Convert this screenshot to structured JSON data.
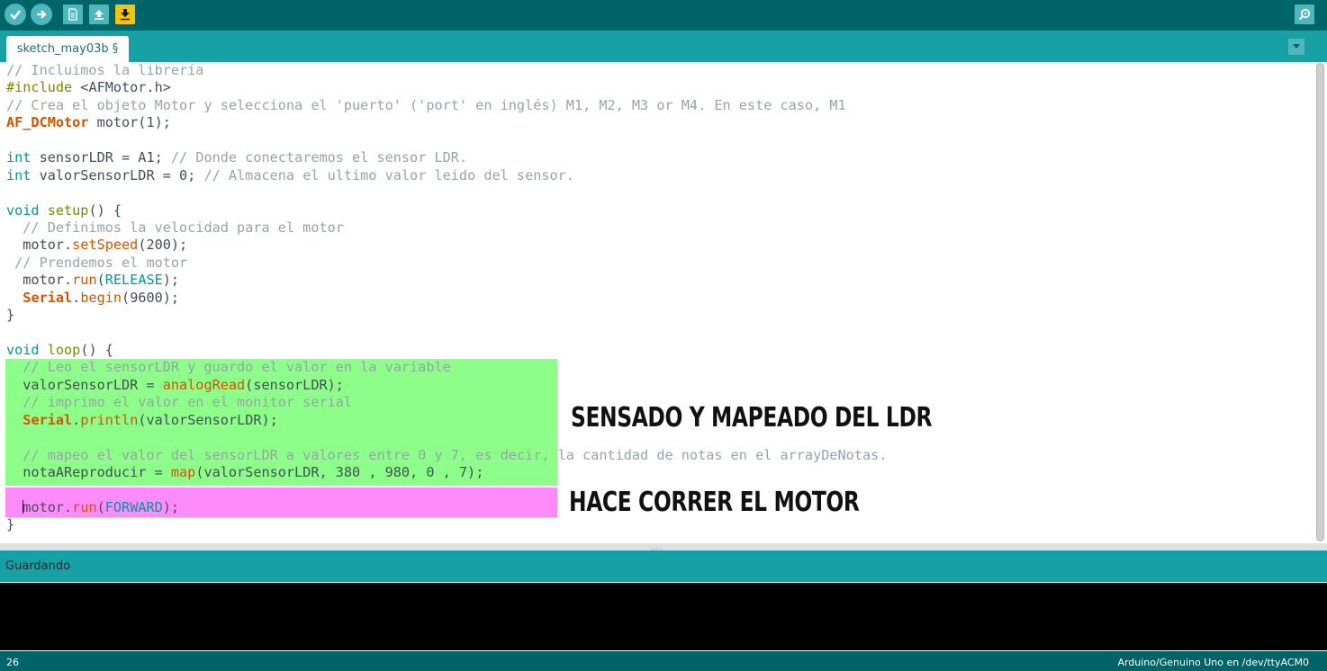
{
  "toolbar": {
    "buttons": [
      {
        "name": "verify",
        "icon": "check-icon"
      },
      {
        "name": "upload",
        "icon": "arrow-right-icon"
      },
      {
        "name": "new",
        "icon": "new-file-icon"
      },
      {
        "name": "open",
        "icon": "open-arrow-up-icon"
      },
      {
        "name": "save",
        "icon": "save-arrow-down-icon"
      }
    ],
    "serial_monitor_icon": "magnifier-icon"
  },
  "tab": {
    "label": "sketch_may03b §"
  },
  "code_lines": [
    "// Incluimos la librería",
    "#include <AFMotor.h>",
    "// Crea el objeto Motor y selecciona el 'puerto' ('port' en inglés) M1, M2, M3 or M4. En este caso, M1",
    "AF_DCMotor motor(1);",
    "",
    "int sensorLDR = A1; // Donde conectaremos el sensor LDR.",
    "int valorSensorLDR = 0; // Almacena el ultimo valor leido del sensor.",
    "",
    "void setup() {",
    "  // Definimos la velocidad para el motor",
    "  motor.setSpeed(200);",
    " // Prendemos el motor",
    "  motor.run(RELEASE);",
    "  Serial.begin(9600);",
    "}",
    "",
    "void loop() {",
    "  // Leo el sensorLDR y guardo el valor en la variable",
    "  valorSensorLDR = analogRead(sensorLDR);",
    "  // imprimo el valor en el monitor serial",
    "  Serial.println(valorSensorLDR);",
    "",
    "  // mapeo el valor del sensorLDR a valores entre 0 y 7, es decir, la cantidad de notas en el arrayDeNotas.",
    "  notaAReproducir = map(valorSensorLDR, 380 , 980, 0 , 7);",
    "",
    "  motor.run(FORWARD);",
    "}"
  ],
  "annotations": {
    "sensing": "SENSADO Y MAPEADO DEL LDR",
    "motor": "HACE CORRER EL MOTOR"
  },
  "highlight_colors": {
    "sensing": "#8efe8b",
    "motor": "#fd8cfa"
  },
  "status": {
    "message": "Guardando"
  },
  "footer": {
    "line_number": "26",
    "board": "Arduino/Genuino Uno en /dev/ttyACM0"
  },
  "theme": {
    "toolbar": "#006468",
    "tabbar": "#17a1a5",
    "button": "#4db7bb",
    "save_button": "#f1c40f"
  }
}
